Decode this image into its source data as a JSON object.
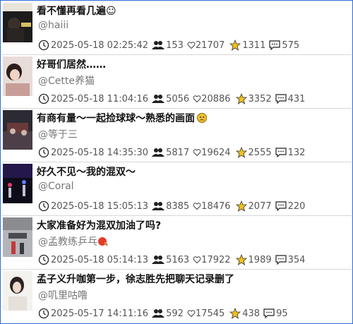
{
  "items": [
    {
      "title": "看不懂再看几遍☺",
      "author": "@haiii",
      "date": "2025-05-18 02:25:42",
      "viewers": "153",
      "likes": "21707",
      "stars": "1311",
      "comments": "575",
      "thumb_colors": [
        "#1a1a1a",
        "#3b2f2a",
        "#c9b28a"
      ]
    },
    {
      "title": "好哥们居然……",
      "author": "@Cette养猫",
      "date": "2025-05-18 11:04:16",
      "viewers": "5056",
      "likes": "20886",
      "stars": "3352",
      "comments": "431",
      "thumb_colors": [
        "#e8d8d4",
        "#b88f88",
        "#7c5a52"
      ]
    },
    {
      "title": "有商有量～一起捡球球～熟悉的画面",
      "author": "@等于三",
      "date": "2025-05-18 14:35:30",
      "viewers": "5817",
      "likes": "19624",
      "stars": "2555",
      "comments": "132",
      "thumb_colors": [
        "#2a2a33",
        "#5a4d55",
        "#a24040"
      ]
    },
    {
      "title": "好久不见～我的混双～",
      "author": "@Coral",
      "date": "2025-05-18 15:05:13",
      "viewers": "8385",
      "likes": "18476",
      "stars": "2077",
      "comments": "220",
      "thumb_colors": [
        "#0c0c18",
        "#3a2a7a",
        "#b0204a"
      ]
    },
    {
      "title": "大家准备好为混双加油了吗?",
      "author": "@孟教练乒乓",
      "date": "2025-05-18 05:14:13",
      "viewers": "5163",
      "likes": "17922",
      "stars": "1989",
      "comments": "354",
      "thumb_colors": [
        "#8a8c90",
        "#b6b6ba",
        "#c23a3a"
      ]
    },
    {
      "title": "孟子义升咖第一步，徐志胜先把聊天记录删了",
      "author": "@叽里咕噜",
      "date": "2025-05-17 14:11:16",
      "viewers": "592",
      "likes": "17545",
      "stars": "438",
      "comments": "95",
      "thumb_colors": [
        "#f4f2ef",
        "#d8cfc7",
        "#3a2d28"
      ]
    }
  ],
  "icons": {
    "clock": "clock-icon",
    "viewers": "people-icon",
    "likes": "heart-icon",
    "stars": "star-icon",
    "comments": "comment-icon"
  },
  "colors": {
    "frame_border": "#2b6fd6",
    "star": "#f2c21b",
    "title": "#111111",
    "author": "#777777"
  }
}
